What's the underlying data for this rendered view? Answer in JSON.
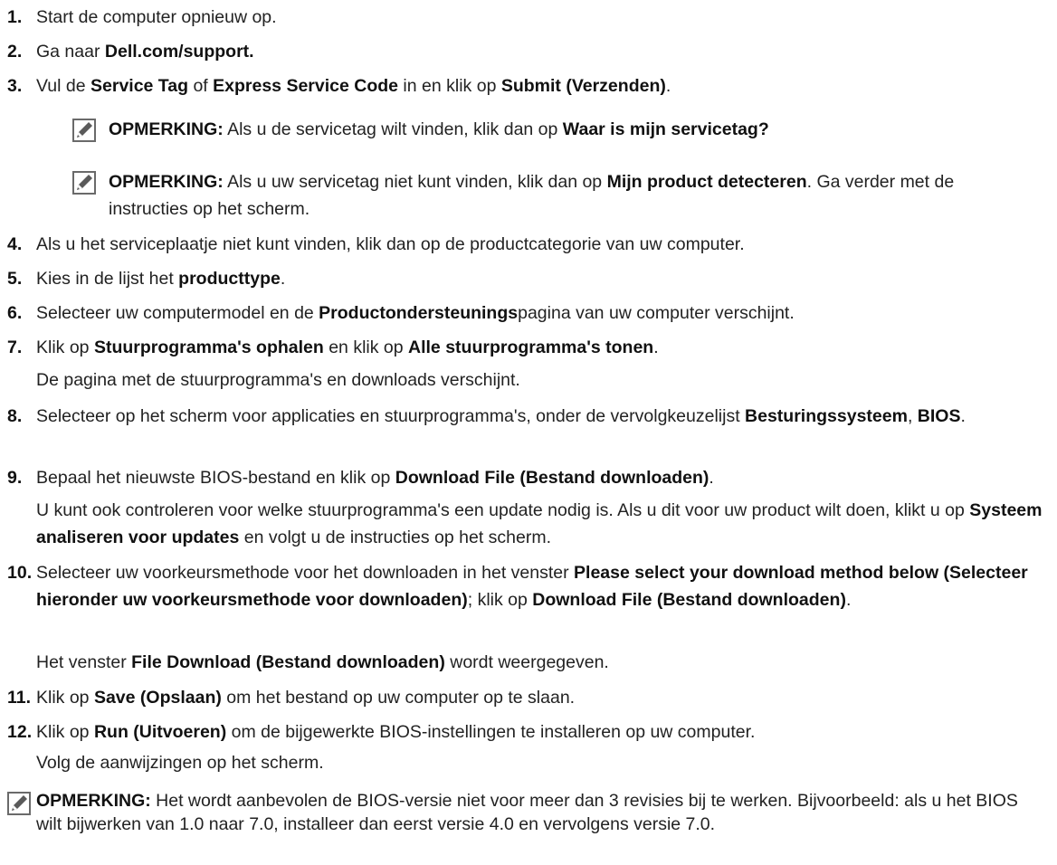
{
  "steps": [
    {
      "num": "1.",
      "parts": [
        {
          "t": "Start de computer opnieuw op."
        }
      ]
    },
    {
      "num": "2.",
      "parts": [
        {
          "t": "Ga naar "
        },
        {
          "t": "Dell.com/support.",
          "b": true
        }
      ]
    },
    {
      "num": "3.",
      "parts": [
        {
          "t": "Vul de "
        },
        {
          "t": "Service Tag",
          "b": true
        },
        {
          "t": " of "
        },
        {
          "t": "Express Service Code",
          "b": true
        },
        {
          "t": " in en klik op "
        },
        {
          "t": "Submit (Verzenden)",
          "b": true
        },
        {
          "t": "."
        }
      ]
    },
    {
      "num": "4.",
      "parts": [
        {
          "t": "Als u het serviceplaatje niet kunt vinden, klik dan op de productcategorie van uw computer."
        }
      ]
    },
    {
      "num": "5.",
      "parts": [
        {
          "t": "Kies in de lijst het "
        },
        {
          "t": "producttype",
          "b": true
        },
        {
          "t": "."
        }
      ]
    },
    {
      "num": "6.",
      "parts": [
        {
          "t": "Selecteer uw computermodel en de "
        },
        {
          "t": "Productondersteunings",
          "b": true
        },
        {
          "t": "pagina van uw computer verschijnt."
        }
      ]
    },
    {
      "num": "7.",
      "parts": [
        {
          "t": "Klik op "
        },
        {
          "t": "Stuurprogramma's ophalen",
          "b": true
        },
        {
          "t": " en klik op "
        },
        {
          "t": "Alle stuurprogramma's tonen",
          "b": true
        },
        {
          "t": "."
        }
      ]
    },
    {
      "num": "8.",
      "parts": [
        {
          "t": "Selecteer op het scherm voor applicaties en stuurprogramma's, onder de vervolgkeuzelijst "
        },
        {
          "t": "Besturingssysteem",
          "b": true
        },
        {
          "t": ", "
        },
        {
          "t": "BIOS",
          "b": true
        },
        {
          "t": "."
        }
      ]
    },
    {
      "num": "9.",
      "parts": [
        {
          "t": "Bepaal het nieuwste BIOS-bestand en klik op "
        },
        {
          "t": "Download File (Bestand downloaden)",
          "b": true
        },
        {
          "t": "."
        }
      ]
    },
    {
      "num": "10.",
      "parts": [
        {
          "t": "Selecteer uw voorkeursmethode voor het downloaden in het venster "
        },
        {
          "t": "Please select your download method below (Selecteer hieronder uw voorkeursmethode voor downloaden)",
          "b": true
        },
        {
          "t": "; klik op "
        },
        {
          "t": "Download File (Bestand downloaden)",
          "b": true
        },
        {
          "t": "."
        }
      ]
    },
    {
      "num": "11.",
      "parts": [
        {
          "t": "Klik op "
        },
        {
          "t": "Save (Opslaan)",
          "b": true
        },
        {
          "t": " om het bestand op uw computer op te slaan."
        }
      ]
    },
    {
      "num": "12.",
      "parts": [
        {
          "t": "Klik op "
        },
        {
          "t": "Run (Uitvoeren)",
          "b": true
        },
        {
          "t": " om de bijgewerkte BIOS-instellingen te installeren op uw computer."
        }
      ]
    }
  ],
  "subparas": {
    "s7": [
      {
        "t": "De pagina met de stuurprogramma's en downloads verschijnt."
      }
    ],
    "s9": [
      {
        "t": "U kunt ook controleren voor welke stuurprogramma's een update nodig is. Als u dit voor uw product wilt doen, klikt u op "
      },
      {
        "t": "Systeem analiseren voor updates",
        "b": true
      },
      {
        "t": " en volgt u de instructies op het scherm."
      }
    ],
    "s10": [
      {
        "t": "Het venster "
      },
      {
        "t": "File Download (Bestand downloaden)",
        "b": true
      },
      {
        "t": " wordt weergegeven."
      }
    ],
    "s12": [
      {
        "t": "Volg de aanwijzingen op het scherm."
      }
    ]
  },
  "notes": {
    "n1": [
      {
        "t": "OPMERKING:",
        "b": true
      },
      {
        "t": " Als u de servicetag wilt vinden, klik dan op "
      },
      {
        "t": "Waar is mijn servicetag?",
        "b": true
      }
    ],
    "n2": [
      {
        "t": "OPMERKING:",
        "b": true
      },
      {
        "t": " Als u uw servicetag niet kunt vinden, klik dan op "
      },
      {
        "t": "Mijn product detecteren",
        "b": true
      },
      {
        "t": ". Ga verder met de instructies op het scherm."
      }
    ],
    "n3": [
      {
        "t": "OPMERKING:",
        "b": true
      },
      {
        "t": " Het wordt aanbevolen de BIOS-versie niet voor meer dan 3 revisies bij te werken. Bijvoorbeeld: als u het BIOS wilt bijwerken van 1.0 naar 7.0, installeer dan eerst versie 4.0 en vervolgens versie 7.0."
      }
    ]
  },
  "icons": {
    "note": "pencil-note-icon"
  },
  "colors": {
    "text": "#222222",
    "bold": "#111111",
    "icon": "#5a5a5a"
  }
}
